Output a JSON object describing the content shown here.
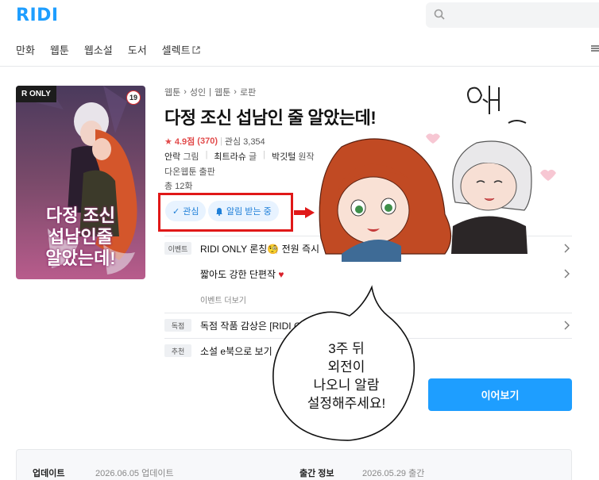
{
  "header": {
    "logo": "RIDI",
    "nav": [
      "만화",
      "웹툰",
      "웹소설",
      "도서",
      "셀렉트"
    ]
  },
  "cover": {
    "badge": "R ONLY",
    "age": "19",
    "title_lines": [
      "다정 조신",
      "섭남인줄",
      "알았는데!"
    ]
  },
  "book": {
    "breadcrumb": [
      "웹툰",
      "성인",
      "웹툰",
      "로판"
    ],
    "title": "다정 조신 섭남인 줄 알았는데!",
    "rating": "4.9점",
    "rating_count": "(370)",
    "interest": "관심 3,354",
    "authors": [
      {
        "name": "안락",
        "role": "그림"
      },
      {
        "name": "최트라슈",
        "role": "글"
      },
      {
        "name": "박깃털",
        "role": "원작"
      }
    ],
    "publisher": "다온웹툰 출판",
    "total": "총 12화"
  },
  "actions": {
    "watch": "관심",
    "alarm": "알림 받는 중"
  },
  "events": [
    {
      "tag": "이벤트",
      "text": "RIDI ONLY 론칭🧐 전원 즉시"
    },
    {
      "tag": "",
      "text": "짧아도 강한 단편작"
    },
    {
      "tag": "독점",
      "text": "독점 작품 감상은 [RIDI O"
    },
    {
      "tag": "추천",
      "text": "소설 e북으로 보기"
    }
  ],
  "events_more": "이벤트 더보기",
  "continue_button": "이어보기",
  "info": {
    "update_label": "업데이트",
    "update_value": "2026.06.05 업데이트",
    "publish_label": "출간 정보",
    "publish_value": "2026.05.29 출간"
  },
  "overlay": {
    "exclamation": "와~",
    "bubble_lines": [
      "3주 뒤",
      "외전이",
      "나오니 알람",
      "설정해주세요!"
    ]
  },
  "colors": {
    "brand": "#1e9eff",
    "highlight": "#e01818"
  }
}
